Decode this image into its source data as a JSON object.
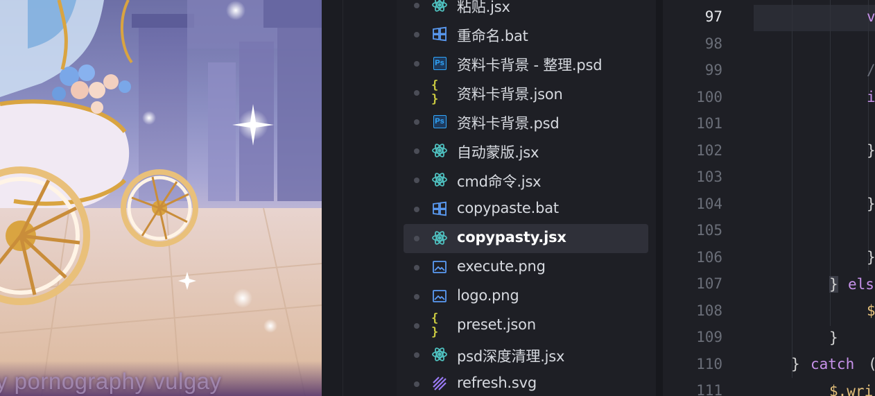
{
  "artwork": {
    "watermark_text": "y pornography vulgay",
    "colors": {
      "sky": "#8c8fc3",
      "gold": "#d9a441",
      "roses": "#7aa7e8"
    }
  },
  "explorer": {
    "files": [
      {
        "name": "粘贴.jsx",
        "icon": "react-icon",
        "active": false
      },
      {
        "name": "重命名.bat",
        "icon": "windows-icon",
        "active": false
      },
      {
        "name": "资料卡背景 - 整理.psd",
        "icon": "photoshop-icon",
        "active": false
      },
      {
        "name": "资料卡背景.json",
        "icon": "json-braces-icon",
        "active": false
      },
      {
        "name": "资料卡背景.psd",
        "icon": "photoshop-icon",
        "active": false
      },
      {
        "name": "自动蒙版.jsx",
        "icon": "react-icon",
        "active": false
      },
      {
        "name": "cmd命令.jsx",
        "icon": "react-icon",
        "active": false
      },
      {
        "name": "copypaste.bat",
        "icon": "windows-icon",
        "active": false
      },
      {
        "name": "copypasty.jsx",
        "icon": "react-icon",
        "active": true
      },
      {
        "name": "execute.png",
        "icon": "image-icon",
        "active": false
      },
      {
        "name": "logo.png",
        "icon": "image-icon",
        "active": false
      },
      {
        "name": "preset.json",
        "icon": "json-braces-icon",
        "active": false
      },
      {
        "name": "psd深度清理.jsx",
        "icon": "react-icon",
        "active": false
      },
      {
        "name": "refresh.svg",
        "icon": "svg-icon",
        "active": false
      }
    ],
    "icon_colors": {
      "react": "#4fc1c0",
      "windows": "#5b9cf5",
      "photoshop": "#31a8ff",
      "json": "#cbcb41",
      "image": "#5b9cf5",
      "svg": "#9b7bf7"
    }
  },
  "editor": {
    "current_line": "97",
    "line_numbers": [
      "97",
      "98",
      "99",
      "100",
      "101",
      "102",
      "103",
      "104",
      "105",
      "106",
      "107",
      "108",
      "109",
      "110",
      "111"
    ],
    "code_fragments": {
      "l97": "v",
      "l99": "/",
      "l100": "i",
      "l102": "}",
      "l104": "}",
      "l106": "}",
      "l107_brace": "}",
      "l107_kw": "els",
      "l108": "$",
      "l109": "}",
      "l110_brace": "}",
      "l110_kw": "catch",
      "l110_paren": "(",
      "l111": "$.wri"
    }
  }
}
